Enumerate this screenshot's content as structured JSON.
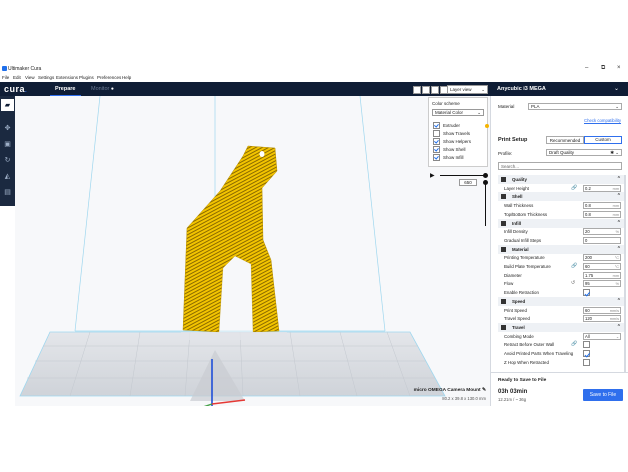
{
  "window": {
    "title": "Ultimaker Cura"
  },
  "menu": [
    "File",
    "Edit",
    "View",
    "Settings",
    "Extensions",
    "Plugins",
    "Preferences",
    "Help"
  ],
  "header": {
    "brand": "cura",
    "brand_dot": ".",
    "tabs": [
      "Prepare",
      "Monitor"
    ]
  },
  "printer": {
    "name": "Anycubic i3 MEGA"
  },
  "view": {
    "mode": "Layer view"
  },
  "color_scheme": {
    "label": "Color scheme",
    "selected": "Material Color",
    "options": [
      {
        "label": "Extruder",
        "checked": true
      },
      {
        "label": "Show Travels",
        "checked": false
      },
      {
        "label": "Show Helpers",
        "checked": true
      },
      {
        "label": "Show Shell",
        "checked": true
      },
      {
        "label": "Show Infill",
        "checked": true
      }
    ],
    "extruder_color": "#f5b400"
  },
  "layer": {
    "current": "650"
  },
  "material": {
    "label": "Material",
    "value": "PLA",
    "check_link": "Check compatibility"
  },
  "print_setup": {
    "title": "Print Setup",
    "recommended": "Recommended",
    "custom": "Custom",
    "profile_label": "Profile:",
    "profile_value": "Draft Quality",
    "search_placeholder": "Search..."
  },
  "settings": [
    {
      "type": "cat",
      "label": "Quality"
    },
    {
      "type": "val",
      "label": "Layer Height",
      "value": "0.2",
      "unit": "mm",
      "link": true
    },
    {
      "type": "cat",
      "label": "Shell"
    },
    {
      "type": "val",
      "label": "Wall Thickness",
      "value": "0.8",
      "unit": "mm"
    },
    {
      "type": "val",
      "label": "Top/Bottom Thickness",
      "value": "0.8",
      "unit": "mm"
    },
    {
      "type": "cat",
      "label": "Infill"
    },
    {
      "type": "val",
      "label": "Infill Density",
      "value": "20",
      "unit": "%"
    },
    {
      "type": "val",
      "label": "Gradual Infill Steps",
      "value": "0",
      "unit": ""
    },
    {
      "type": "cat",
      "label": "Material"
    },
    {
      "type": "val",
      "label": "Printing Temperature",
      "value": "200",
      "unit": "°C"
    },
    {
      "type": "val",
      "label": "Build Plate Temperature",
      "value": "60",
      "unit": "°C",
      "link": true
    },
    {
      "type": "val",
      "label": "Diameter",
      "value": "1.75",
      "unit": "mm"
    },
    {
      "type": "val",
      "label": "Flow",
      "value": "95",
      "unit": "%",
      "reset": true
    },
    {
      "type": "chk",
      "label": "Enable Retraction",
      "checked": true
    },
    {
      "type": "cat",
      "label": "Speed"
    },
    {
      "type": "val",
      "label": "Print Speed",
      "value": "60",
      "unit": "mm/s"
    },
    {
      "type": "val",
      "label": "Travel Speed",
      "value": "120",
      "unit": "mm/s"
    },
    {
      "type": "cat",
      "label": "Travel"
    },
    {
      "type": "sel",
      "label": "Combing Mode",
      "value": "All"
    },
    {
      "type": "chk",
      "label": "Retract Before Outer Wall",
      "checked": false,
      "link": true
    },
    {
      "type": "chk",
      "label": "Avoid Printed Parts When Traveling",
      "checked": true
    },
    {
      "type": "chk",
      "label": "Z Hop When Retracted",
      "checked": false
    }
  ],
  "model": {
    "name": "micro OMEGA Camera Mount",
    "dims": "80.2 x 39.8 x 130.0 mm"
  },
  "output": {
    "status": "Ready to Save to File",
    "time": "03h 03min",
    "material": "12.21m / ~ 36g",
    "save": "Save to File"
  },
  "colors": {
    "accent": "#2f6fed",
    "header": "#0f1d35",
    "model": "#f2c200"
  }
}
